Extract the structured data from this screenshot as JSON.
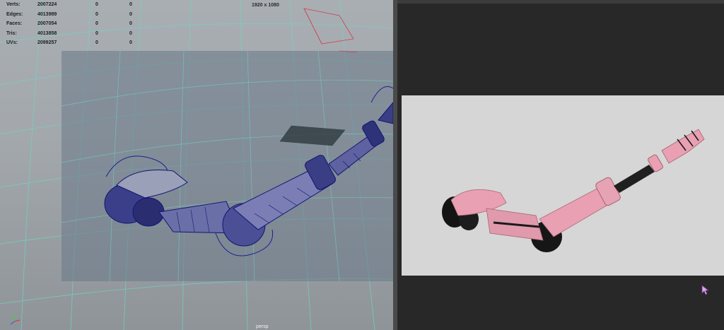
{
  "viewport": {
    "stats": [
      {
        "label": "Verts:",
        "value": "2007224",
        "sel1": "0",
        "sel2": "0"
      },
      {
        "label": "Edges:",
        "value": "4013989",
        "sel1": "0",
        "sel2": "0"
      },
      {
        "label": "Faces:",
        "value": "2007054",
        "sel1": "0",
        "sel2": "0"
      },
      {
        "label": "Tris:",
        "value": "4013858",
        "sel1": "0",
        "sel2": "0"
      },
      {
        "label": "UVs:",
        "value": "2099257",
        "sel1": "0",
        "sel2": "0"
      }
    ],
    "resolution": "1920 x 1080",
    "camera": "persp",
    "colors": {
      "grid": "#6fd4c4",
      "wire": "#13156e",
      "gate": "#6a7888"
    }
  },
  "render_view": {
    "colors": {
      "background": "#d6d6d6",
      "arm": "#e8a0b2",
      "joint": "#141414"
    },
    "icons": [
      "arrow-cursor-icon"
    ]
  }
}
